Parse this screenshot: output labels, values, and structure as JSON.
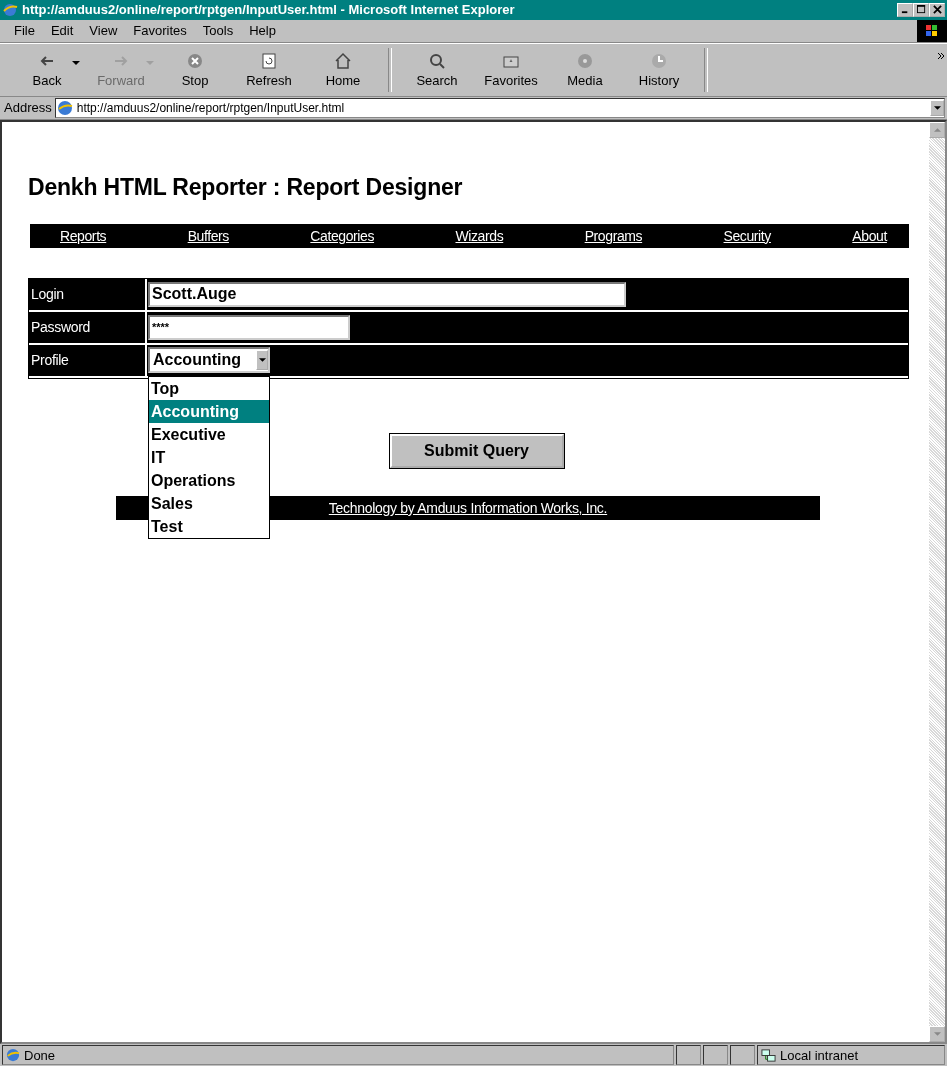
{
  "window": {
    "title": "http://amduus2/online/report/rptgen/InputUser.html - Microsoft Internet Explorer"
  },
  "menu": [
    "File",
    "Edit",
    "View",
    "Favorites",
    "Tools",
    "Help"
  ],
  "toolbar": [
    {
      "label": "Back",
      "kind": "back",
      "disabled": false,
      "dropdown": true
    },
    {
      "label": "Forward",
      "kind": "forward",
      "disabled": true,
      "dropdown": true
    },
    {
      "label": "Stop",
      "kind": "stop",
      "disabled": false,
      "dropdown": false
    },
    {
      "label": "Refresh",
      "kind": "refresh",
      "disabled": false,
      "dropdown": false
    },
    {
      "label": "Home",
      "kind": "home",
      "disabled": false,
      "dropdown": false
    },
    {
      "label": "Search",
      "kind": "search",
      "disabled": false,
      "dropdown": false
    },
    {
      "label": "Favorites",
      "kind": "favorites",
      "disabled": false,
      "dropdown": false
    },
    {
      "label": "Media",
      "kind": "media",
      "disabled": false,
      "dropdown": false
    },
    {
      "label": "History",
      "kind": "history",
      "disabled": false,
      "dropdown": false
    }
  ],
  "address": {
    "label": "Address",
    "value": "http://amduus2/online/report/rptgen/InputUser.html"
  },
  "page": {
    "heading": "Denkh HTML Reporter : Report Designer",
    "nav": [
      "Reports",
      "Buffers",
      "Categories",
      "Wizards",
      "Programs",
      "Security",
      "About"
    ],
    "form": {
      "login": {
        "label": "Login",
        "value": "Scott.Auge"
      },
      "password": {
        "label": "Password",
        "value": "****"
      },
      "profile": {
        "label": "Profile",
        "value": "Accounting",
        "expanded": true,
        "options": [
          {
            "label": "Top",
            "selected": false
          },
          {
            "label": "Accounting",
            "selected": true
          },
          {
            "label": "Executive",
            "selected": false
          },
          {
            "label": "IT",
            "selected": false
          },
          {
            "label": "Operations",
            "selected": false
          },
          {
            "label": "Sales",
            "selected": false
          },
          {
            "label": "Test",
            "selected": false
          }
        ]
      },
      "submit": "Submit Query"
    },
    "footer": "Technology by Amduus Information Works, Inc."
  },
  "status_bar": {
    "text": "Done",
    "zone": "Local intranet"
  }
}
